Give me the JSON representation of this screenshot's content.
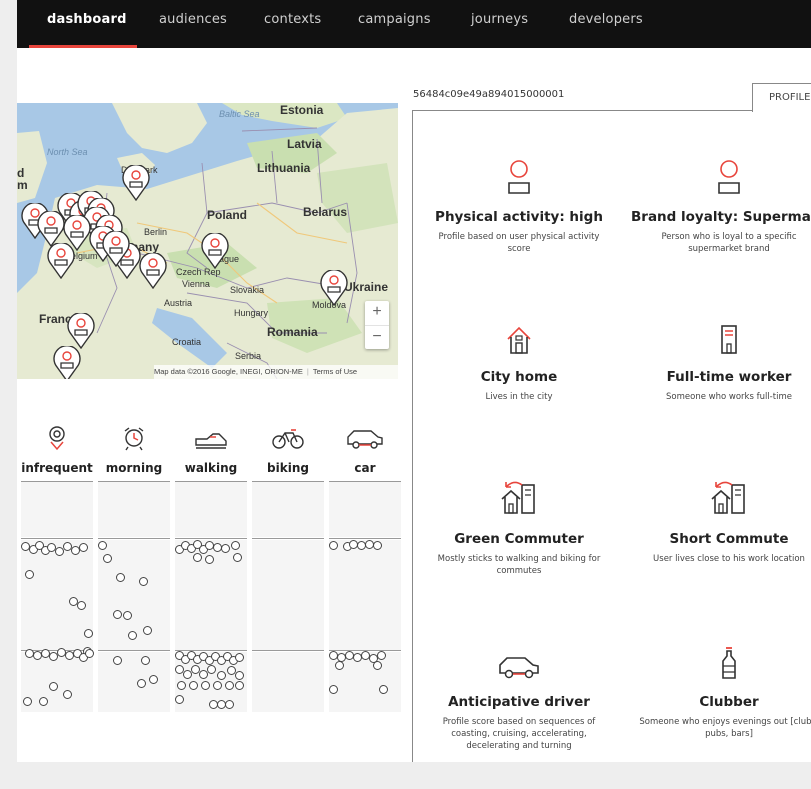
{
  "nav": {
    "items": [
      {
        "label": "dashboard",
        "active": true
      },
      {
        "label": "audiences"
      },
      {
        "label": "contexts"
      },
      {
        "label": "campaigns"
      },
      {
        "label": "journeys"
      },
      {
        "label": "developers"
      }
    ]
  },
  "map": {
    "labels": {
      "baltic_sea": "Baltic Sea",
      "north_sea": "North Sea",
      "estonia": "Estonia",
      "latvia": "Latvia",
      "lithuania": "Lithuania",
      "denmark": "Denmark",
      "poland": "Poland",
      "belarus": "Belarus",
      "germany": "Germany",
      "belgium": "Belgium",
      "berlin": "Berlin",
      "prague": "Prague",
      "czech_rep": "Czech Rep",
      "vienna": "Vienna",
      "slovakia": "Slovakia",
      "austria": "Austria",
      "hungary": "Hungary",
      "ukraine": "Ukraine",
      "moldova": "Moldova",
      "romania": "Romania",
      "france": "France",
      "croatia": "Croatia",
      "serbia": "Serbia",
      "edge_d": "d",
      "edge_m": "m"
    },
    "zoom_in": "+",
    "zoom_out": "−",
    "attribution": "Map data ©2016 Google, INEGI, ORION-ME",
    "terms": "Terms of Use"
  },
  "modes": {
    "columns": [
      {
        "label": "infrequent",
        "icon": "location-pin-icon"
      },
      {
        "label": "morning",
        "icon": "alarm-clock-icon"
      },
      {
        "label": "walking",
        "icon": "shoe-icon"
      },
      {
        "label": "biking",
        "icon": "bicycle-icon"
      },
      {
        "label": "car",
        "icon": "car-icon"
      }
    ]
  },
  "profile": {
    "id": "56484c09e49a894015000001",
    "tab_label": "PROFILE",
    "cards": [
      {
        "title": "Physical activity: high",
        "description": "Profile based on user physical activity score",
        "icon": "user-icon"
      },
      {
        "title": "Brand loyalty: Supermarket",
        "description": "Person who is loyal to a specific supermarket brand",
        "icon": "user-icon"
      },
      {
        "title": "City home",
        "description": "Lives in the city",
        "icon": "house-icon"
      },
      {
        "title": "Full-time worker",
        "description": "Someone who works full-time",
        "icon": "office-building-icon"
      },
      {
        "title": "Green Commuter",
        "description": "Mostly sticks to walking and biking for commutes",
        "icon": "commute-icon"
      },
      {
        "title": "Short Commute",
        "description": "User lives close to his work location",
        "icon": "commute-icon"
      },
      {
        "title": "Anticipative driver",
        "description": "Profile score based on sequences of coasting, cruising, accelerating, decelerating and turning",
        "icon": "car-icon"
      },
      {
        "title": "Clubber",
        "description": "Someone who enjoys evenings out [clubs, pubs, bars]",
        "icon": "bottle-icon"
      }
    ]
  },
  "colors": {
    "accent": "#e8453c",
    "nav_bg": "#111111",
    "water": "#a8c8e6",
    "land": "#e6ead2",
    "forest": "#c9dfb0"
  }
}
